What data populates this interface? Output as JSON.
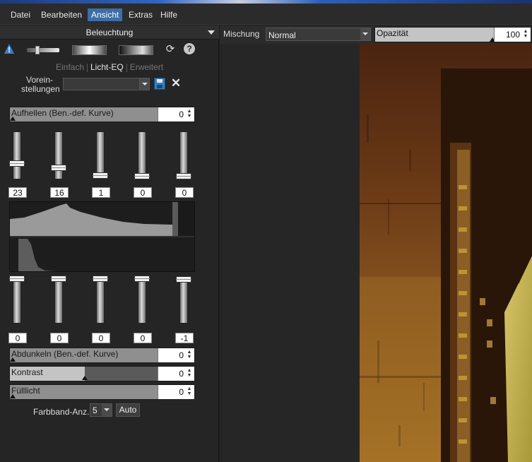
{
  "menu": {
    "items": [
      {
        "label": "Datei"
      },
      {
        "label": "Bearbeiten"
      },
      {
        "label": "Ansicht"
      },
      {
        "label": "Extras"
      },
      {
        "label": "Hilfe"
      }
    ],
    "active": "Ansicht"
  },
  "panel": {
    "title": "Beleuchtung",
    "tabs": [
      "Einfach",
      "Licht-EQ",
      "Erweitert"
    ],
    "active_tab": "Licht-EQ",
    "presets_label": "Vorein-stellungen",
    "presets_value": "",
    "brighten": {
      "label": "Aufhellen (Ben.-def. Kurve)",
      "value": "0"
    },
    "brighten_bands": [
      "23",
      "16",
      "1",
      "0",
      "0"
    ],
    "brighten_levels": [
      0.23,
      0.16,
      0.01,
      0.0,
      0.0
    ],
    "darken_bands": [
      "0",
      "0",
      "0",
      "0",
      "-1"
    ],
    "darken_levels": [
      0.0,
      0.0,
      0.0,
      0.0,
      0.01
    ],
    "darken": {
      "label": "Abdunkeln (Ben.-def. Kurve)",
      "value": "0"
    },
    "contrast": {
      "label": "Kontrast",
      "value": "0"
    },
    "fill_light": {
      "label": "Fülllicht",
      "value": "0"
    },
    "band_count_label": "Farbband-Anz.:",
    "band_count_value": "5",
    "auto_label": "Auto"
  },
  "blend": {
    "label": "Mischung",
    "mode": "Normal",
    "opacity_label": "Opazität",
    "opacity_value": "100"
  },
  "colors": {
    "accent": "#3e6da8",
    "warning": "#3d7fc4"
  }
}
